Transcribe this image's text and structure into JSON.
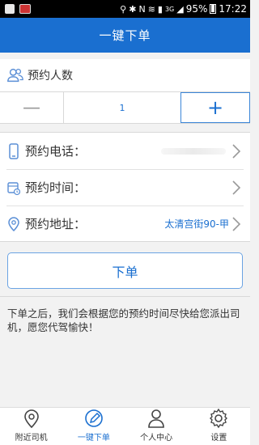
{
  "status_bar": {
    "icons": [
      "thumbnail-icon",
      "app-icon",
      "location-icon",
      "bluetooth-icon",
      "nfc-icon",
      "wifi-icon",
      "sim-icon",
      "signal-icon",
      "battery-icon"
    ],
    "nfc": "N",
    "network": "3G",
    "battery_level": 0.95,
    "battery": "95%",
    "time": "17:22"
  },
  "header": {
    "title": "一键下单"
  },
  "passengers": {
    "label": "预约人数",
    "minus_label": "—",
    "count": "1",
    "plus_label": "+"
  },
  "form": {
    "phone_label": "预约电话：",
    "time_label": "预约时间：",
    "address_label": "预约地址：",
    "address_value": "太清宫街90-甲"
  },
  "order_button": {
    "label": "下单"
  },
  "note": {
    "text": "下单之后，我们会根据您的预约时间尽快给您派出司机，愿您代驾愉快！"
  },
  "tabbar": {
    "nearby": "附近司机",
    "order": "一键下单",
    "profile": "个人中心",
    "settings": "设置"
  },
  "colors": {
    "accent": "#1a6fd0",
    "background": "#f2f2f2"
  }
}
